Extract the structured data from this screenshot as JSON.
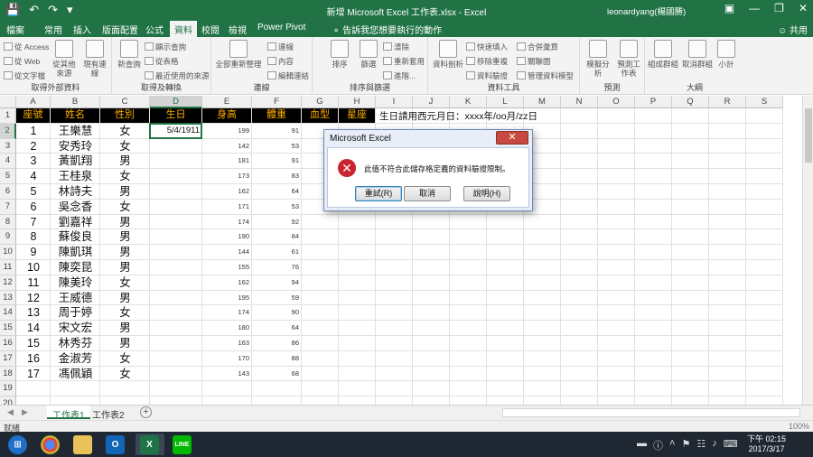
{
  "window": {
    "title": "新增 Microsoft Excel 工作表.xlsx  -  Excel",
    "user": "leonardyang(楊國勝)"
  },
  "tabs": [
    "檔案",
    "常用",
    "插入",
    "版面配置",
    "公式",
    "資料",
    "校閱",
    "檢視",
    "Power Pivot"
  ],
  "tell_me": "告訴我您想要執行的動作",
  "share": "共用",
  "ribbon": {
    "groups": [
      {
        "label": "取得外部資料",
        "items": [
          "從 Access",
          "從 Web",
          "從文字檔",
          "從其他來源",
          "現有連線"
        ]
      },
      {
        "label": "取得及轉換",
        "items": [
          "新查詢",
          "顯示查詢",
          "從表格",
          "最近使用的來源"
        ]
      },
      {
        "label": "連線",
        "items": [
          "全部重新整理",
          "連線",
          "內容",
          "編輯連結"
        ]
      },
      {
        "label": "排序與篩選",
        "items": [
          "排序",
          "篩選",
          "清除",
          "重新套用",
          "進階..."
        ]
      },
      {
        "label": "資料工具",
        "items": [
          "資料剖析",
          "快速填入",
          "移除重複",
          "資料驗證",
          "合併彙算",
          "關聯圖",
          "管理資料模型"
        ]
      },
      {
        "label": "預測",
        "items": [
          "模擬分析",
          "預測工作表"
        ]
      },
      {
        "label": "大綱",
        "items": [
          "組成群組",
          "取消群組",
          "小計"
        ]
      }
    ]
  },
  "columns": [
    "A",
    "B",
    "C",
    "D",
    "E",
    "F",
    "G",
    "H",
    "I",
    "J",
    "K",
    "L",
    "M",
    "N",
    "O",
    "P",
    "Q",
    "R",
    "S"
  ],
  "headers": [
    "座號",
    "姓名",
    "性別",
    "生日",
    "身高",
    "體重",
    "血型",
    "星座"
  ],
  "note": "生日請用西元月日：xxxx年/oo月/zz日",
  "rows": [
    {
      "no": "1",
      "name": "王樂慧",
      "gender": "女",
      "birthday": "5/4/1911",
      "height": "199",
      "weight": "91"
    },
    {
      "no": "2",
      "name": "安秀玲",
      "gender": "女",
      "birthday": "",
      "height": "142",
      "weight": "53"
    },
    {
      "no": "3",
      "name": "黃凱翔",
      "gender": "男",
      "birthday": "",
      "height": "181",
      "weight": "91"
    },
    {
      "no": "4",
      "name": "王桂泉",
      "gender": "女",
      "birthday": "",
      "height": "173",
      "weight": "83"
    },
    {
      "no": "5",
      "name": "林詩夫",
      "gender": "男",
      "birthday": "",
      "height": "162",
      "weight": "64"
    },
    {
      "no": "6",
      "name": "吳念香",
      "gender": "女",
      "birthday": "",
      "height": "171",
      "weight": "53"
    },
    {
      "no": "7",
      "name": "劉嘉祥",
      "gender": "男",
      "birthday": "",
      "height": "174",
      "weight": "92"
    },
    {
      "no": "8",
      "name": "蘇俊良",
      "gender": "男",
      "birthday": "",
      "height": "190",
      "weight": "84"
    },
    {
      "no": "9",
      "name": "陳凱琪",
      "gender": "男",
      "birthday": "",
      "height": "144",
      "weight": "61"
    },
    {
      "no": "10",
      "name": "陳奕昆",
      "gender": "男",
      "birthday": "",
      "height": "155",
      "weight": "76"
    },
    {
      "no": "11",
      "name": "陳美玲",
      "gender": "女",
      "birthday": "",
      "height": "162",
      "weight": "94"
    },
    {
      "no": "12",
      "name": "王威德",
      "gender": "男",
      "birthday": "",
      "height": "195",
      "weight": "59"
    },
    {
      "no": "13",
      "name": "周于婷",
      "gender": "女",
      "birthday": "",
      "height": "174",
      "weight": "90"
    },
    {
      "no": "14",
      "name": "宋文宏",
      "gender": "男",
      "birthday": "",
      "height": "180",
      "weight": "64"
    },
    {
      "no": "15",
      "name": "林秀芬",
      "gender": "男",
      "birthday": "",
      "height": "163",
      "weight": "86"
    },
    {
      "no": "16",
      "name": "金淑芳",
      "gender": "女",
      "birthday": "",
      "height": "170",
      "weight": "88"
    },
    {
      "no": "17",
      "name": "馮佩穎",
      "gender": "女",
      "birthday": "",
      "height": "143",
      "weight": "68"
    }
  ],
  "row_numbers": [
    "1",
    "2",
    "3",
    "4",
    "5",
    "6",
    "7",
    "8",
    "9",
    "10",
    "11",
    "12",
    "13",
    "14",
    "15",
    "16",
    "17",
    "18",
    "19",
    "20"
  ],
  "sheets": [
    "工作表1",
    "工作表2"
  ],
  "status": {
    "ready": "就緒",
    "zoom": "100%"
  },
  "dialog": {
    "title": "Microsoft Excel",
    "close": "✕",
    "message": "此值不符合此儲存格定義的資料驗證限制。",
    "retry": "重試(R)",
    "cancel": "取消",
    "help": "說明(H)"
  },
  "taskbar": {
    "time": "下午 02:15",
    "date": "2017/3/17"
  },
  "colors": {
    "excel_green": "#217346",
    "header_bg": "#000000",
    "header_text": "#ffae00",
    "error_red": "#c8252c"
  }
}
